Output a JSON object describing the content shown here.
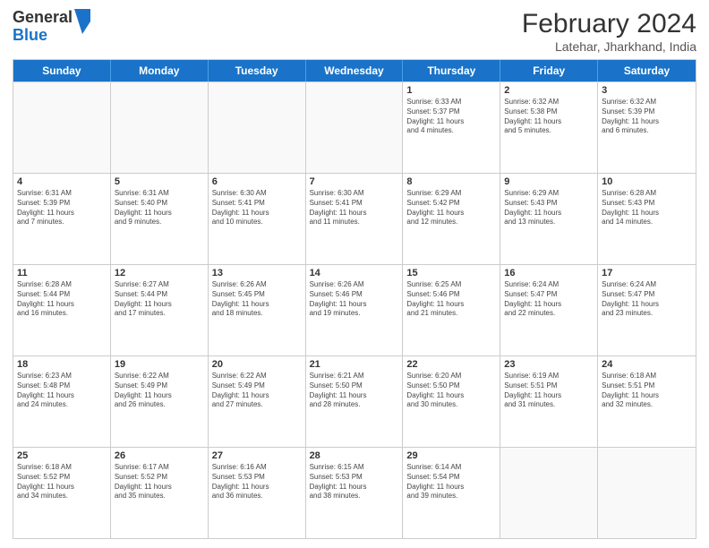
{
  "header": {
    "logo": {
      "line1": "General",
      "line2": "Blue"
    },
    "title": "February 2024",
    "subtitle": "Latehar, Jharkhand, India"
  },
  "days": [
    "Sunday",
    "Monday",
    "Tuesday",
    "Wednesday",
    "Thursday",
    "Friday",
    "Saturday"
  ],
  "weeks": [
    [
      {
        "date": "",
        "info": ""
      },
      {
        "date": "",
        "info": ""
      },
      {
        "date": "",
        "info": ""
      },
      {
        "date": "",
        "info": ""
      },
      {
        "date": "1",
        "info": "Sunrise: 6:33 AM\nSunset: 5:37 PM\nDaylight: 11 hours\nand 4 minutes."
      },
      {
        "date": "2",
        "info": "Sunrise: 6:32 AM\nSunset: 5:38 PM\nDaylight: 11 hours\nand 5 minutes."
      },
      {
        "date": "3",
        "info": "Sunrise: 6:32 AM\nSunset: 5:39 PM\nDaylight: 11 hours\nand 6 minutes."
      }
    ],
    [
      {
        "date": "4",
        "info": "Sunrise: 6:31 AM\nSunset: 5:39 PM\nDaylight: 11 hours\nand 7 minutes."
      },
      {
        "date": "5",
        "info": "Sunrise: 6:31 AM\nSunset: 5:40 PM\nDaylight: 11 hours\nand 9 minutes."
      },
      {
        "date": "6",
        "info": "Sunrise: 6:30 AM\nSunset: 5:41 PM\nDaylight: 11 hours\nand 10 minutes."
      },
      {
        "date": "7",
        "info": "Sunrise: 6:30 AM\nSunset: 5:41 PM\nDaylight: 11 hours\nand 11 minutes."
      },
      {
        "date": "8",
        "info": "Sunrise: 6:29 AM\nSunset: 5:42 PM\nDaylight: 11 hours\nand 12 minutes."
      },
      {
        "date": "9",
        "info": "Sunrise: 6:29 AM\nSunset: 5:43 PM\nDaylight: 11 hours\nand 13 minutes."
      },
      {
        "date": "10",
        "info": "Sunrise: 6:28 AM\nSunset: 5:43 PM\nDaylight: 11 hours\nand 14 minutes."
      }
    ],
    [
      {
        "date": "11",
        "info": "Sunrise: 6:28 AM\nSunset: 5:44 PM\nDaylight: 11 hours\nand 16 minutes."
      },
      {
        "date": "12",
        "info": "Sunrise: 6:27 AM\nSunset: 5:44 PM\nDaylight: 11 hours\nand 17 minutes."
      },
      {
        "date": "13",
        "info": "Sunrise: 6:26 AM\nSunset: 5:45 PM\nDaylight: 11 hours\nand 18 minutes."
      },
      {
        "date": "14",
        "info": "Sunrise: 6:26 AM\nSunset: 5:46 PM\nDaylight: 11 hours\nand 19 minutes."
      },
      {
        "date": "15",
        "info": "Sunrise: 6:25 AM\nSunset: 5:46 PM\nDaylight: 11 hours\nand 21 minutes."
      },
      {
        "date": "16",
        "info": "Sunrise: 6:24 AM\nSunset: 5:47 PM\nDaylight: 11 hours\nand 22 minutes."
      },
      {
        "date": "17",
        "info": "Sunrise: 6:24 AM\nSunset: 5:47 PM\nDaylight: 11 hours\nand 23 minutes."
      }
    ],
    [
      {
        "date": "18",
        "info": "Sunrise: 6:23 AM\nSunset: 5:48 PM\nDaylight: 11 hours\nand 24 minutes."
      },
      {
        "date": "19",
        "info": "Sunrise: 6:22 AM\nSunset: 5:49 PM\nDaylight: 11 hours\nand 26 minutes."
      },
      {
        "date": "20",
        "info": "Sunrise: 6:22 AM\nSunset: 5:49 PM\nDaylight: 11 hours\nand 27 minutes."
      },
      {
        "date": "21",
        "info": "Sunrise: 6:21 AM\nSunset: 5:50 PM\nDaylight: 11 hours\nand 28 minutes."
      },
      {
        "date": "22",
        "info": "Sunrise: 6:20 AM\nSunset: 5:50 PM\nDaylight: 11 hours\nand 30 minutes."
      },
      {
        "date": "23",
        "info": "Sunrise: 6:19 AM\nSunset: 5:51 PM\nDaylight: 11 hours\nand 31 minutes."
      },
      {
        "date": "24",
        "info": "Sunrise: 6:18 AM\nSunset: 5:51 PM\nDaylight: 11 hours\nand 32 minutes."
      }
    ],
    [
      {
        "date": "25",
        "info": "Sunrise: 6:18 AM\nSunset: 5:52 PM\nDaylight: 11 hours\nand 34 minutes."
      },
      {
        "date": "26",
        "info": "Sunrise: 6:17 AM\nSunset: 5:52 PM\nDaylight: 11 hours\nand 35 minutes."
      },
      {
        "date": "27",
        "info": "Sunrise: 6:16 AM\nSunset: 5:53 PM\nDaylight: 11 hours\nand 36 minutes."
      },
      {
        "date": "28",
        "info": "Sunrise: 6:15 AM\nSunset: 5:53 PM\nDaylight: 11 hours\nand 38 minutes."
      },
      {
        "date": "29",
        "info": "Sunrise: 6:14 AM\nSunset: 5:54 PM\nDaylight: 11 hours\nand 39 minutes."
      },
      {
        "date": "",
        "info": ""
      },
      {
        "date": "",
        "info": ""
      }
    ]
  ]
}
